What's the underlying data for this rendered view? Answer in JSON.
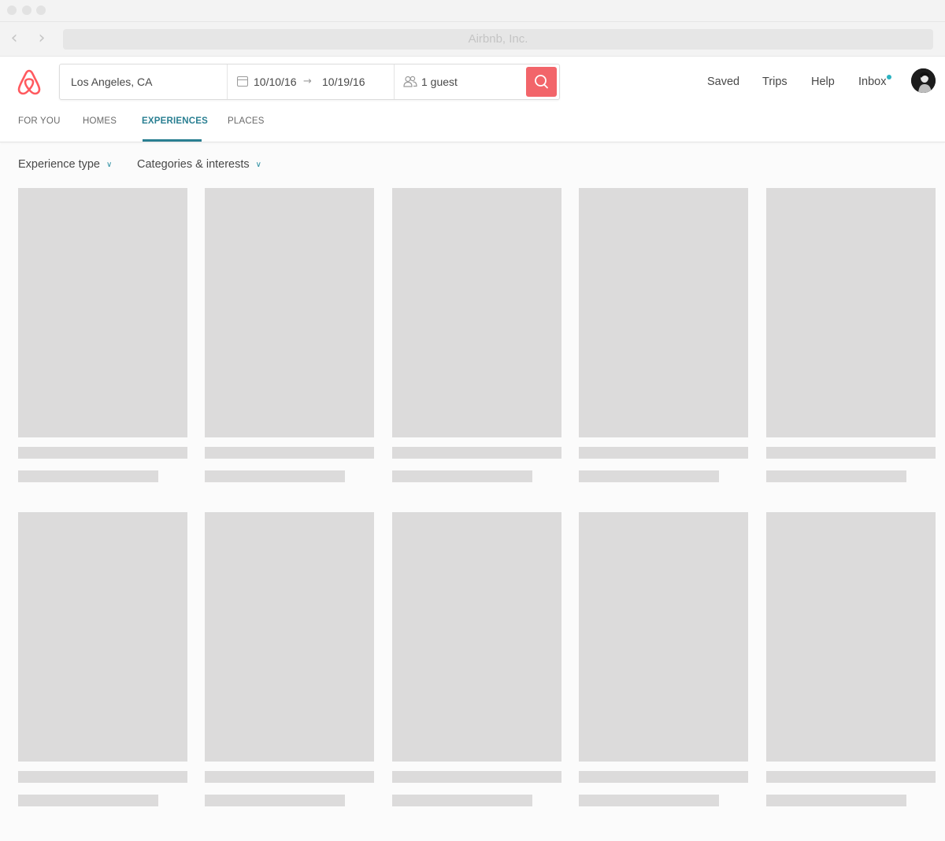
{
  "browser": {
    "url_text": "Airbnb, Inc.",
    "back_icon": "chevron-left-icon",
    "forward_icon": "chevron-right-icon"
  },
  "search": {
    "location": "Los Angeles, CA",
    "checkin": "10/10/16",
    "checkout": "10/19/16",
    "guests": "1 guest",
    "search_icon": "magnifier-icon",
    "button_color": "#f2656a"
  },
  "nav": {
    "saved": "Saved",
    "trips": "Trips",
    "help": "Help",
    "inbox": "Inbox",
    "inbox_badge_color": "#2bb2c1"
  },
  "tabs": [
    {
      "label": "FOR YOU"
    },
    {
      "label": "HOMES"
    },
    {
      "label": "EXPERIENCES",
      "active": true
    },
    {
      "label": "PLACES"
    }
  ],
  "filters": [
    {
      "label": "Experience type"
    },
    {
      "label": "Categories & interests"
    }
  ],
  "colors": {
    "brand": "#ff5a5f",
    "accent": "#2a7f92",
    "skeleton": "#dcdbdb"
  }
}
